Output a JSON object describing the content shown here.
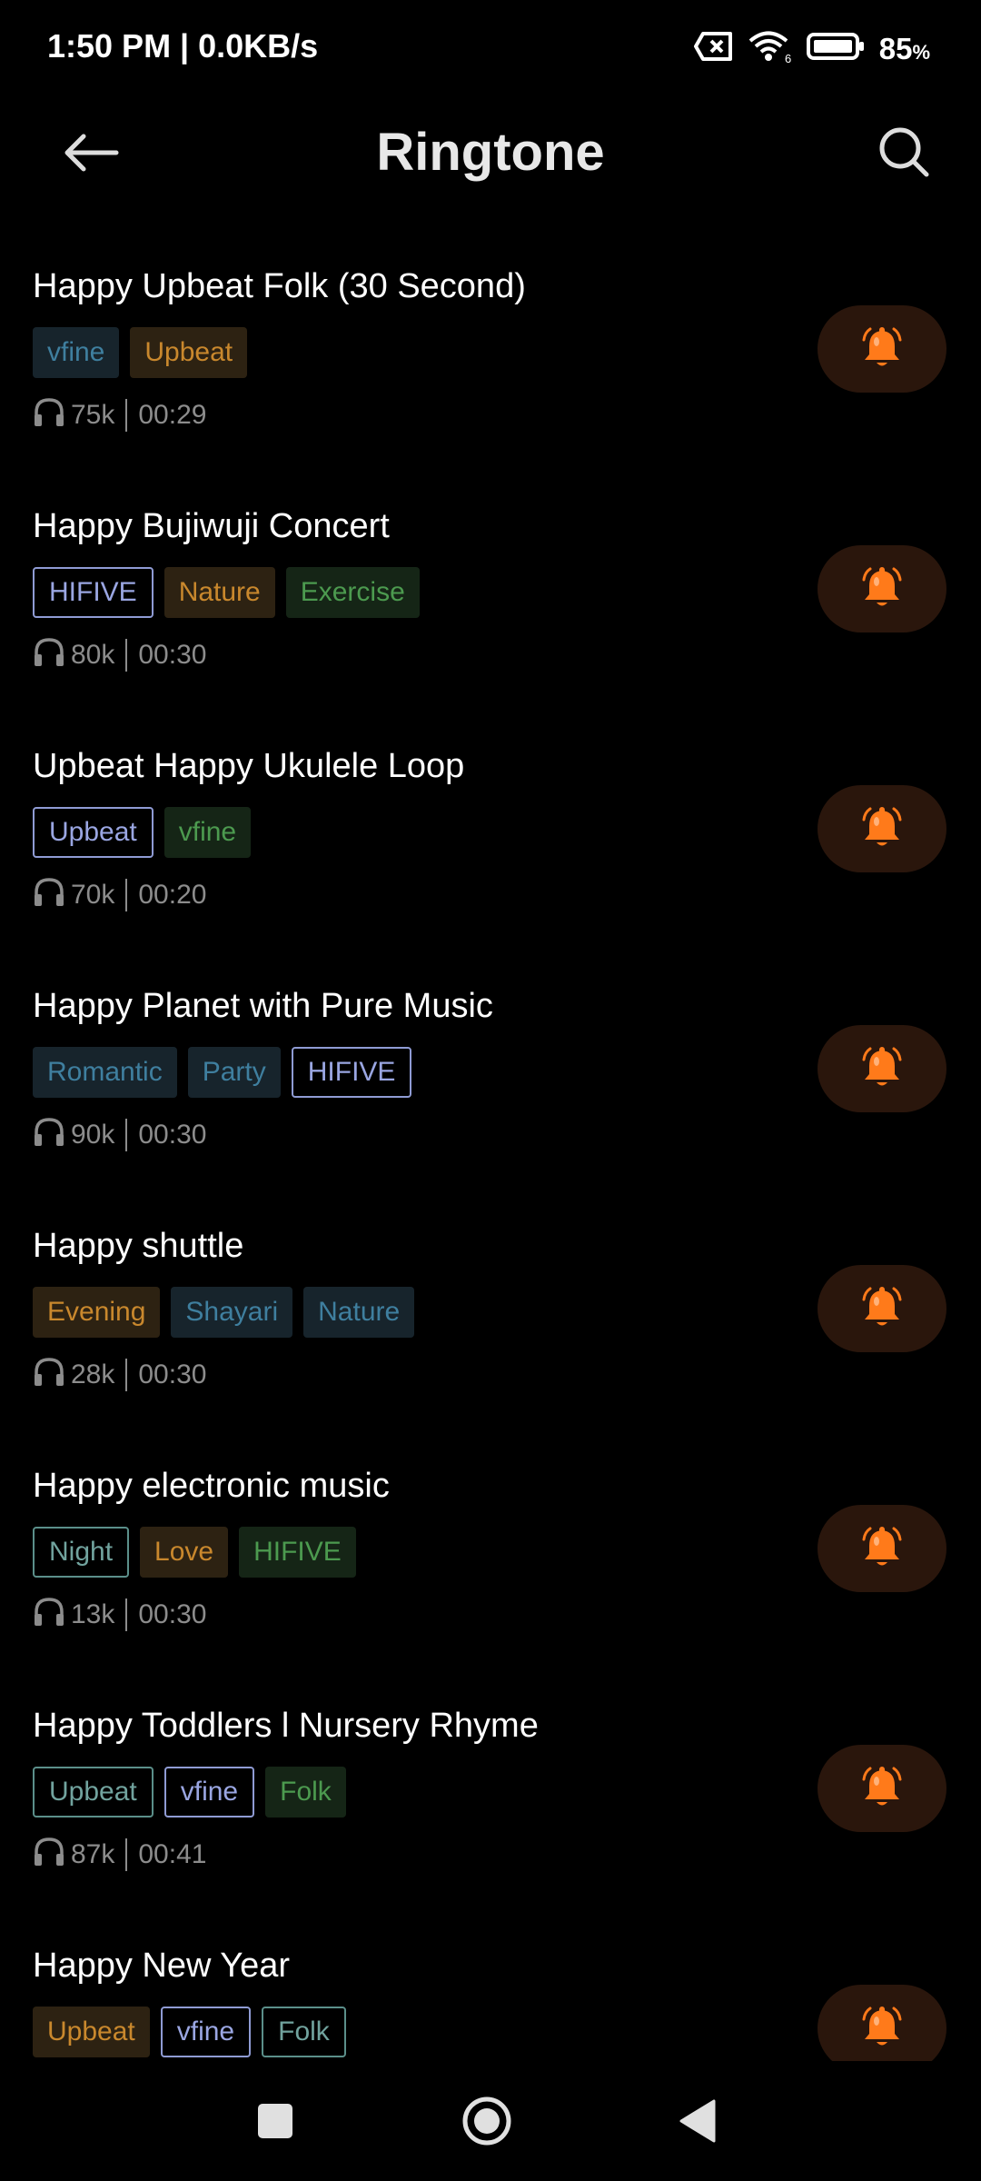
{
  "status_bar": {
    "time_speed": "1:50 PM | 0.0KB/s",
    "battery_percent": "85",
    "battery_unit": "%"
  },
  "header": {
    "title": "Ringtone",
    "back_icon": "arrow-left-icon",
    "search_icon": "search-icon"
  },
  "colors": {
    "accent_bell": "#ff7a1a",
    "bell_bg": "#2a160c",
    "tag_blue": "#3f7f9f",
    "tag_orange": "#c9882d",
    "tag_green": "#4c9a4f",
    "tag_outline_purple": "#9aa6e2",
    "tag_outline_teal": "#71a39e"
  },
  "ringtones": [
    {
      "title": "Happy Upbeat Folk (30 Second)",
      "tags": [
        {
          "label": "vfine",
          "style": "blue"
        },
        {
          "label": "Upbeat",
          "style": "orange"
        }
      ],
      "plays": "75k",
      "duration": "00:29"
    },
    {
      "title": "Happy Bujiwuji Concert",
      "tags": [
        {
          "label": "HIFIVE",
          "style": "outline-purple"
        },
        {
          "label": "Nature",
          "style": "orange"
        },
        {
          "label": "Exercise",
          "style": "green"
        }
      ],
      "plays": "80k",
      "duration": "00:30"
    },
    {
      "title": "Upbeat Happy Ukulele Loop",
      "tags": [
        {
          "label": "Upbeat",
          "style": "outline-purple"
        },
        {
          "label": "vfine",
          "style": "green"
        }
      ],
      "plays": "70k",
      "duration": "00:20"
    },
    {
      "title": "Happy Planet with Pure Music",
      "tags": [
        {
          "label": "Romantic",
          "style": "blue"
        },
        {
          "label": "Party",
          "style": "blue"
        },
        {
          "label": "HIFIVE",
          "style": "outline-purple"
        }
      ],
      "plays": "90k",
      "duration": "00:30"
    },
    {
      "title": "Happy shuttle",
      "tags": [
        {
          "label": "Evening",
          "style": "orange"
        },
        {
          "label": "Shayari",
          "style": "blue"
        },
        {
          "label": "Nature",
          "style": "blue"
        }
      ],
      "plays": "28k",
      "duration": "00:30"
    },
    {
      "title": "Happy electronic music",
      "tags": [
        {
          "label": "Night",
          "style": "outline-teal"
        },
        {
          "label": "Love",
          "style": "orange"
        },
        {
          "label": "HIFIVE",
          "style": "green"
        }
      ],
      "plays": "13k",
      "duration": "00:30"
    },
    {
      "title": "Happy Toddlers l Nursery Rhyme",
      "tags": [
        {
          "label": "Upbeat",
          "style": "outline-teal"
        },
        {
          "label": "vfine",
          "style": "outline-purple"
        },
        {
          "label": "Folk",
          "style": "green"
        }
      ],
      "plays": "87k",
      "duration": "00:41"
    },
    {
      "title": "Happy New Year",
      "tags": [
        {
          "label": "Upbeat",
          "style": "orange"
        },
        {
          "label": "vfine",
          "style": "outline-purple"
        },
        {
          "label": "Folk",
          "style": "outline-teal"
        }
      ],
      "plays": "",
      "duration": ""
    }
  ],
  "nav_bar": {
    "recents_icon": "square-icon",
    "home_icon": "circle-icon",
    "back_icon": "triangle-back-icon"
  }
}
